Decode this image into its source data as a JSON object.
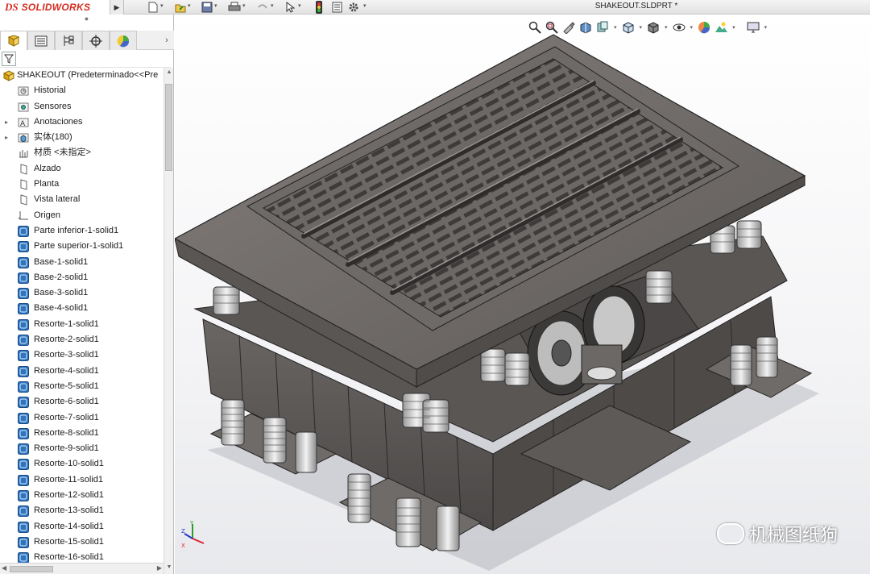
{
  "app": {
    "brand_ds": "DS",
    "brand_name": "SOLIDWORKS",
    "document_title": "SHAKEOUT.SLDPRT *"
  },
  "toolbar": {
    "icons": [
      "new-icon",
      "open-icon",
      "save-icon",
      "print-icon",
      "undo-icon",
      "select-icon",
      "rebuild-icon",
      "file-properties-icon",
      "options-icon"
    ]
  },
  "feature_tree": {
    "root_label": "SHAKEOUT  (Predeterminado<<Pre",
    "items": [
      {
        "label": "Historial",
        "icon": "history-folder-icon",
        "expandable": false
      },
      {
        "label": "Sensores",
        "icon": "sensors-folder-icon",
        "expandable": false
      },
      {
        "label": "Anotaciones",
        "icon": "annotations-folder-icon",
        "expandable": true
      },
      {
        "label": "实体(180)",
        "icon": "solid-bodies-folder-icon",
        "expandable": true
      },
      {
        "label": "材质 <未指定>",
        "icon": "material-icon",
        "expandable": false
      },
      {
        "label": "Alzado",
        "icon": "plane-icon",
        "expandable": false
      },
      {
        "label": "Planta",
        "icon": "plane-icon",
        "expandable": false
      },
      {
        "label": "Vista lateral",
        "icon": "plane-icon",
        "expandable": false
      },
      {
        "label": "Origen",
        "icon": "origin-icon",
        "expandable": false
      },
      {
        "label": "Parte inferior-1-solid1",
        "icon": "body-icon",
        "expandable": false
      },
      {
        "label": "Parte superior-1-solid1",
        "icon": "body-icon",
        "expandable": false
      },
      {
        "label": "Base-1-solid1",
        "icon": "body-icon",
        "expandable": false
      },
      {
        "label": "Base-2-solid1",
        "icon": "body-icon",
        "expandable": false
      },
      {
        "label": "Base-3-solid1",
        "icon": "body-icon",
        "expandable": false
      },
      {
        "label": "Base-4-solid1",
        "icon": "body-icon",
        "expandable": false
      },
      {
        "label": "Resorte-1-solid1",
        "icon": "body-icon",
        "expandable": false
      },
      {
        "label": "Resorte-2-solid1",
        "icon": "body-icon",
        "expandable": false
      },
      {
        "label": "Resorte-3-solid1",
        "icon": "body-icon",
        "expandable": false
      },
      {
        "label": "Resorte-4-solid1",
        "icon": "body-icon",
        "expandable": false
      },
      {
        "label": "Resorte-5-solid1",
        "icon": "body-icon",
        "expandable": false
      },
      {
        "label": "Resorte-6-solid1",
        "icon": "body-icon",
        "expandable": false
      },
      {
        "label": "Resorte-7-solid1",
        "icon": "body-icon",
        "expandable": false
      },
      {
        "label": "Resorte-8-solid1",
        "icon": "body-icon",
        "expandable": false
      },
      {
        "label": "Resorte-9-solid1",
        "icon": "body-icon",
        "expandable": false
      },
      {
        "label": "Resorte-10-solid1",
        "icon": "body-icon",
        "expandable": false
      },
      {
        "label": "Resorte-11-solid1",
        "icon": "body-icon",
        "expandable": false
      },
      {
        "label": "Resorte-12-solid1",
        "icon": "body-icon",
        "expandable": false
      },
      {
        "label": "Resorte-13-solid1",
        "icon": "body-icon",
        "expandable": false
      },
      {
        "label": "Resorte-14-solid1",
        "icon": "body-icon",
        "expandable": false
      },
      {
        "label": "Resorte-15-solid1",
        "icon": "body-icon",
        "expandable": false
      },
      {
        "label": "Resorte-16-solid1",
        "icon": "body-icon",
        "expandable": false
      }
    ]
  },
  "panel_tabs": [
    "feature-manager-tab",
    "property-manager-tab",
    "configuration-manager-tab",
    "dimxpert-tab",
    "display-manager-tab"
  ],
  "view_toolbar": {
    "icons": [
      "zoom-to-fit-icon",
      "zoom-area-icon",
      "previous-view-icon",
      "section-view-icon",
      "dynamic-annotation-icon",
      "view-orientation-icon",
      "display-style-icon",
      "hide-show-items-icon",
      "edit-appearance-icon",
      "apply-scene-icon",
      "view-settings-icon"
    ]
  },
  "triad": {
    "x": "X",
    "y": "Y",
    "z": "Z"
  },
  "watermark": {
    "text": "机械图纸狗"
  },
  "colors": {
    "accent": "#d52b1e",
    "body_icon": "#2f74bd",
    "model": "#6a6664"
  }
}
